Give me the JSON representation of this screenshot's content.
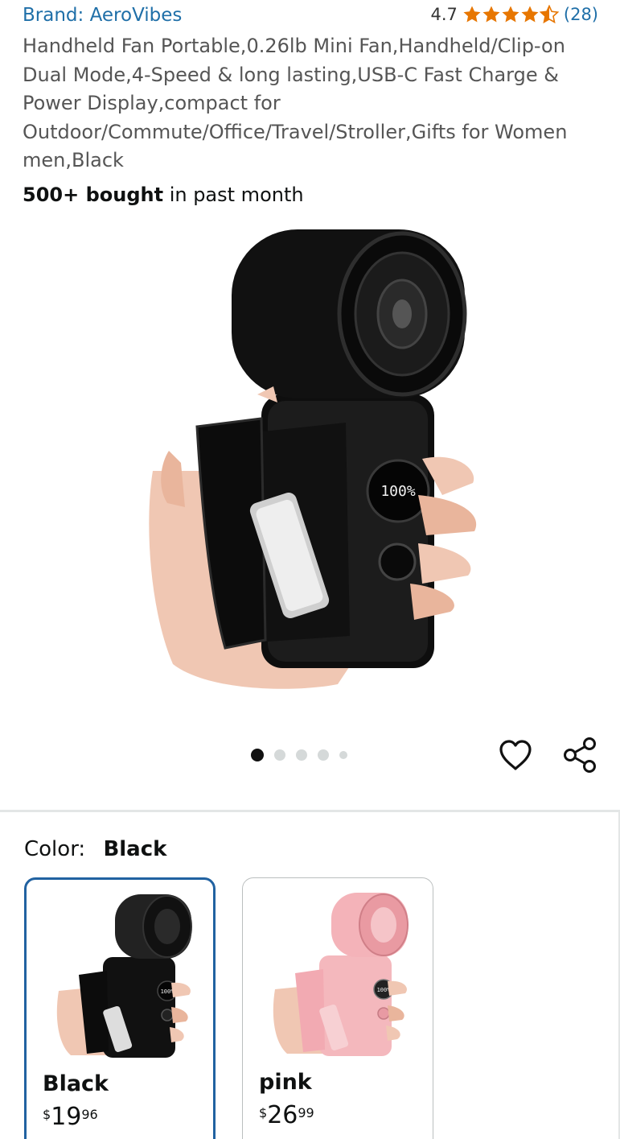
{
  "product": {
    "brand": "Brand: AeroVibes",
    "rating_value": "4.7",
    "rating_stars": 4.7,
    "rating_count": "(28)",
    "title": "Handheld Fan Portable,0.26lb Mini Fan,Handheld/Clip-on Dual Mode,4-Speed & long lasting,USB-C Fast Charge & Power Display,compact for Outdoor/Commute/Office/Travel/Stroller,Gifts for Women men,Black",
    "bought_bold": "500+ bought",
    "bought_rest": " in past month",
    "display_readout": "100%"
  },
  "gallery": {
    "image_count": 5,
    "active_index": 0
  },
  "actions": {
    "favorite_icon": "heart-icon",
    "share_icon": "share-icon"
  },
  "variation": {
    "label": "Color:",
    "selected": "Black",
    "options": [
      {
        "name": "Black",
        "price_symbol": "$",
        "price_whole": "19",
        "price_fraction": "96",
        "selected": true
      },
      {
        "name": "pink",
        "price_symbol": "$",
        "price_whole": "26",
        "price_fraction": "99",
        "selected": false
      }
    ]
  },
  "colors": {
    "link": "#1f6fa8",
    "star": "#e77600",
    "selected_border": "#2162a1"
  }
}
